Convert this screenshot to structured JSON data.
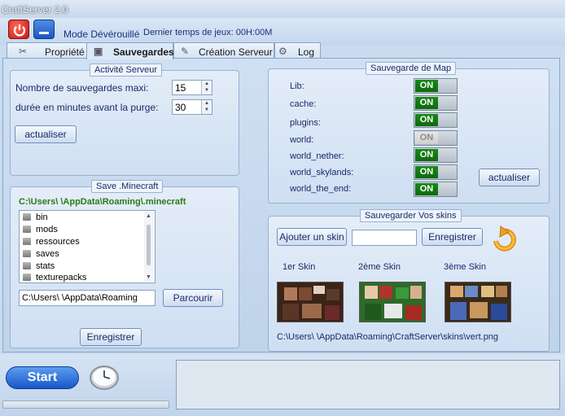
{
  "window": {
    "title": "CraftServer 2.0"
  },
  "topbar": {
    "mode": "Mode Dévérouillé",
    "last_time": "Dernier temps de jeux: 00H:00M"
  },
  "tabs": [
    {
      "label": "Propriété"
    },
    {
      "label": "Sauvegardes"
    },
    {
      "label": "Création Serveur"
    },
    {
      "label": "Log"
    }
  ],
  "activity": {
    "legend": "Activité Serveur",
    "max_saves_label": "Nombre de sauvegardes maxi:",
    "max_saves_value": "15",
    "purge_label": "durée en minutes avant la purge:",
    "purge_value": "30",
    "refresh_label": "actualiser"
  },
  "save_minecraft": {
    "legend": "Save .Minecraft",
    "path": "C:\\Users\\          \\AppData\\Roaming\\.minecraft",
    "folders": [
      "bin",
      "mods",
      "ressources",
      "saves",
      "stats",
      "texturepacks"
    ],
    "path_input": "C:\\Users\\          \\AppData\\Roaming",
    "browse_label": "Parcourir",
    "save_label": "Enregistrer"
  },
  "map_backup": {
    "legend": "Sauvegarde de Map",
    "maps": [
      {
        "name": "Lib:",
        "state": "ON",
        "enabled": true
      },
      {
        "name": "cache:",
        "state": "ON",
        "enabled": true
      },
      {
        "name": "plugins:",
        "state": "ON",
        "enabled": true
      },
      {
        "name": "world:",
        "state": "ON",
        "enabled": false
      },
      {
        "name": "world_nether:",
        "state": "ON",
        "enabled": true
      },
      {
        "name": "world_skylands:",
        "state": "ON",
        "enabled": true
      },
      {
        "name": "world_the_end:",
        "state": "ON",
        "enabled": true
      }
    ],
    "refresh_label": "actualiser"
  },
  "skins": {
    "legend": "Sauvegarder Vos skins",
    "add_label": "Ajouter un skin",
    "name_value": "",
    "save_label": "Enregistrer",
    "titles": [
      "1er Skin",
      "2ème Skin",
      "3ème Skin"
    ],
    "path": "C:\\Users\\          \\AppData\\Roaming\\CraftServer\\skins\\vert.png"
  },
  "bottom": {
    "start_label": "Start"
  },
  "icons": {
    "power": "power-icon",
    "minimize": "minimize-icon",
    "tools": "tools-icon",
    "floppy": "floppy-icon",
    "pencil": "pencil-icon",
    "gears": "gears-icon",
    "clock": "clock-icon",
    "refresh": "refresh-arrow-icon",
    "folder": "folder-icon"
  },
  "colors": {
    "toggle_on": "#1a8a1a",
    "path_green": "#2a7a1a",
    "start_button": "#1658c8",
    "power_button": "#c41a10"
  }
}
